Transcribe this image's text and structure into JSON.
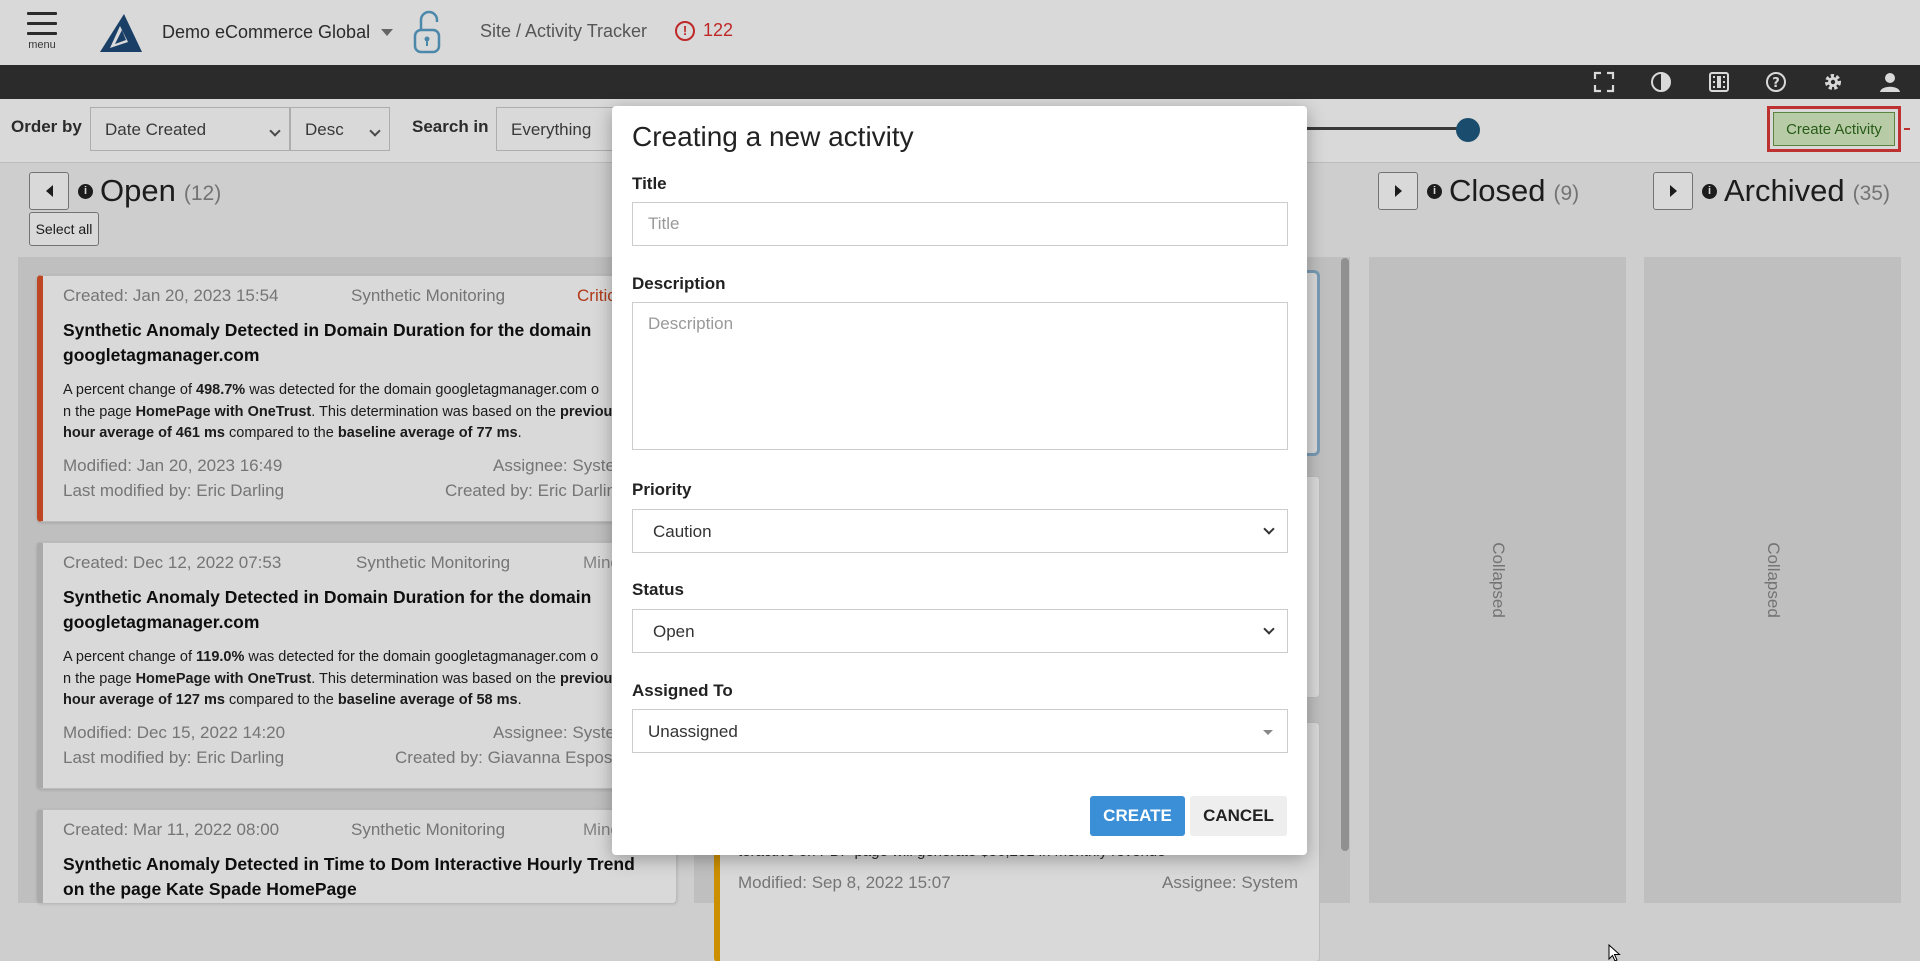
{
  "app": {
    "menu_label": "menu",
    "tenant": "Demo eCommerce Global",
    "breadcrumb": "Site / Activity Tracker",
    "alert_count": "122"
  },
  "toolbar": {
    "icons": [
      "fullscreen-icon",
      "contrast-icon",
      "video-icon",
      "help-icon",
      "settings-icon",
      "user-icon"
    ]
  },
  "filters": {
    "order_by_label": "Order by",
    "order_by_value": "Date Created",
    "order_dir_value": "Desc",
    "search_in_label": "Search in",
    "search_in_value": "Everything",
    "create_activity_label": "Create Activity"
  },
  "columns": {
    "open": {
      "title": "Open",
      "count": "(12)",
      "select_all": "Select all"
    },
    "closed": {
      "title": "Closed",
      "count": "(9)",
      "collapsed": "Collapsed"
    },
    "archived": {
      "title": "Archived",
      "count": "(35)",
      "collapsed": "Collapsed"
    }
  },
  "cards": [
    {
      "created": "Created: Jan 20, 2023 15:54",
      "source": "Synthetic Monitoring",
      "priority": "Critic",
      "title_line1": "Synthetic Anomaly Detected in Domain Duration for the domain",
      "title_line2": "googletagmanager.com",
      "desc1_a": "A percent change of ",
      "desc1_b": "498.7%",
      "desc1_c": " was detected for the domain googletagmanager.com o",
      "desc2_a": "n the page ",
      "desc2_b": "HomePage with OneTrust",
      "desc2_c": ". This determination was based on the ",
      "desc2_d": "previou",
      "desc3_a": "hour average of 461 ms",
      "desc3_b": " compared to the ",
      "desc3_c": "baseline average of 77 ms",
      "desc3_d": ".",
      "modified": "Modified: Jan 20, 2023 16:49",
      "assignee": "Assignee: Syster",
      "last_modified_by": "Last modified by: Eric Darling",
      "created_by": "Created by: Eric Darlin"
    },
    {
      "created": "Created: Dec 12, 2022 07:53",
      "source": "Synthetic Monitoring",
      "priority": "Mino",
      "title_line1": "Synthetic Anomaly Detected in Domain Duration for the domain",
      "title_line2": "googletagmanager.com",
      "desc1_a": "A percent change of ",
      "desc1_b": "119.0%",
      "desc1_c": " was detected for the domain googletagmanager.com o",
      "desc2_a": "n the page ",
      "desc2_b": "HomePage with OneTrust",
      "desc2_c": ". This determination was based on the ",
      "desc2_d": "previou",
      "desc3_a": "hour average of 127 ms",
      "desc3_b": " compared to the ",
      "desc3_c": "baseline average of 58 ms",
      "desc3_d": ".",
      "modified": "Modified: Dec 15, 2022 14:20",
      "assignee": "Assignee: Syster",
      "last_modified_by": "Last modified by: Eric Darling",
      "created_by": "Created by: Giavanna Esposit"
    },
    {
      "created": "Created: Mar 11, 2022 08:00",
      "source": "Synthetic Monitoring",
      "priority": "Mino",
      "title_line1": "Synthetic Anomaly Detected in Time to Dom Interactive Hourly Trend",
      "title_line2": "on the page Kate Spade HomePage"
    }
  ],
  "right_card": {
    "partial_text": "teractive on PDP page will generate $56,201 in monthly revenue",
    "modified": "Modified: Sep 8, 2022 15:07",
    "assignee": "Assignee: System"
  },
  "modal": {
    "title": "Creating a new activity",
    "title_label": "Title",
    "title_placeholder": "Title",
    "description_label": "Description",
    "description_placeholder": "Description",
    "priority_label": "Priority",
    "priority_value": "Caution",
    "status_label": "Status",
    "status_value": "Open",
    "assigned_label": "Assigned To",
    "assigned_value": "Unassigned",
    "create_button": "CREATE",
    "cancel_button": "CANCEL"
  },
  "colors": {
    "critical": "#e05328",
    "caution": "#f0a800",
    "primary": "#3a8fd6",
    "alert": "#e03030"
  }
}
